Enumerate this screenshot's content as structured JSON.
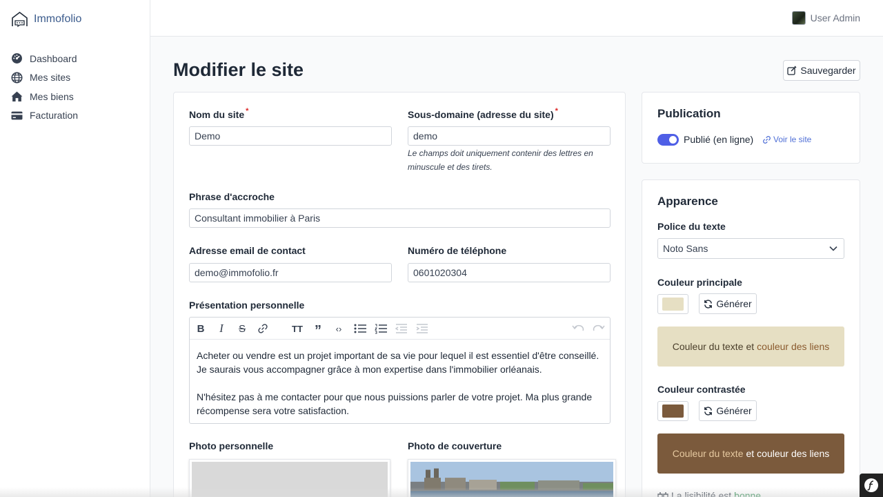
{
  "app": {
    "name": "Immofolio"
  },
  "sidebar": {
    "items": [
      {
        "label": "Dashboard",
        "icon": "gauge-icon"
      },
      {
        "label": "Mes sites",
        "icon": "globe-icon"
      },
      {
        "label": "Mes biens",
        "icon": "home-icon"
      },
      {
        "label": "Facturation",
        "icon": "credit-card-icon"
      }
    ]
  },
  "header": {
    "user_name": "User Admin"
  },
  "page": {
    "title": "Modifier le site",
    "save_label": "Sauvegarder"
  },
  "form": {
    "site_name": {
      "label": "Nom du site",
      "required": "*",
      "value": "Demo"
    },
    "subdomain": {
      "label": "Sous-domaine (adresse du site)",
      "required": "*",
      "value": "demo",
      "hint": "Le champs doit uniquement contenir des lettres en minuscule et des tirets."
    },
    "tagline": {
      "label": "Phrase d'accroche",
      "value": "Consultant immobilier à Paris"
    },
    "email": {
      "label": "Adresse email de contact",
      "value": "demo@immofolio.fr"
    },
    "phone": {
      "label": "Numéro de téléphone",
      "value": "0601020304"
    },
    "presentation": {
      "label": "Présentation personnelle",
      "paragraph1": "Acheter ou vendre est un projet important de sa vie pour lequel il est essentiel d'être conseillé. Je saurais vous accompagner grâce à mon expertise dans l'immobilier orléanais.",
      "paragraph2": " N'hésitez pas à me contacter pour que nous puissions parler de votre projet. Ma plus grande récompense sera votre satisfaction."
    },
    "photo_personal": {
      "label": "Photo personnelle"
    },
    "photo_cover": {
      "label": "Photo de couverture"
    }
  },
  "publication": {
    "title": "Publication",
    "status_label": "Publié (en ligne)",
    "view_link": "Voir le site"
  },
  "appearance": {
    "title": "Apparence",
    "font_label": "Police du texte",
    "font_value": "Noto Sans",
    "primary_label": "Couleur principale",
    "primary_color": "#e6dfc3",
    "generate_label": "Générer",
    "preview_text": "Couleur du texte",
    "preview_and": "et",
    "preview_links": "couleur des liens",
    "contrast_label": "Couleur contrastée",
    "contrast_color": "#7b5a3c",
    "legibility_prefix": "La lisibilité est",
    "legibility_value": "bonne"
  }
}
